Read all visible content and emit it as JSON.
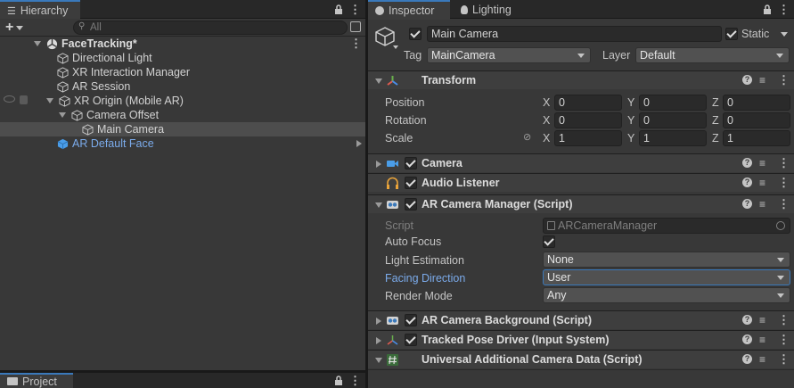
{
  "hierarchy": {
    "tab_label": "Hierarchy",
    "search_placeholder": "All",
    "scene_name": "FaceTracking*",
    "items": [
      {
        "label": "Directional Light"
      },
      {
        "label": "XR Interaction Manager"
      },
      {
        "label": "AR Session"
      },
      {
        "label": "XR Origin (Mobile AR)"
      },
      {
        "label": "Camera Offset"
      },
      {
        "label": "Main Camera"
      },
      {
        "label": "AR Default Face"
      }
    ]
  },
  "project": {
    "tab_label": "Project"
  },
  "inspector": {
    "tabs": [
      {
        "label": "Inspector"
      },
      {
        "label": "Lighting"
      }
    ],
    "object_name": "Main Camera",
    "static_label": "Static",
    "tag_label": "Tag",
    "tag_value": "MainCamera",
    "layer_label": "Layer",
    "layer_value": "Default",
    "transform": {
      "title": "Transform",
      "position_label": "Position",
      "rotation_label": "Rotation",
      "scale_label": "Scale",
      "x": "X",
      "y": "Y",
      "z": "Z",
      "position": [
        "0",
        "0",
        "0"
      ],
      "rotation": [
        "0",
        "0",
        "0"
      ],
      "scale": [
        "1",
        "1",
        "1"
      ]
    },
    "components": {
      "camera": "Camera",
      "audio_listener": "Audio Listener",
      "ar_camera_manager": "AR Camera Manager (Script)",
      "ar_camera_background": "AR Camera Background (Script)",
      "tracked_pose_driver": "Tracked Pose Driver (Input System)",
      "universal_camera_data": "Universal Additional Camera Data (Script)"
    },
    "ar_camera_manager": {
      "script_label": "Script",
      "script_value": "ARCameraManager",
      "auto_focus_label": "Auto Focus",
      "light_estimation_label": "Light Estimation",
      "light_estimation_value": "None",
      "facing_direction_label": "Facing Direction",
      "facing_direction_value": "User",
      "render_mode_label": "Render Mode",
      "render_mode_value": "Any"
    }
  },
  "colors": {
    "accent": "#3a79bb",
    "highlight_label": "#7babeb",
    "selected_row": "#4d4d4d",
    "prefab_blue": "#7babeb"
  }
}
